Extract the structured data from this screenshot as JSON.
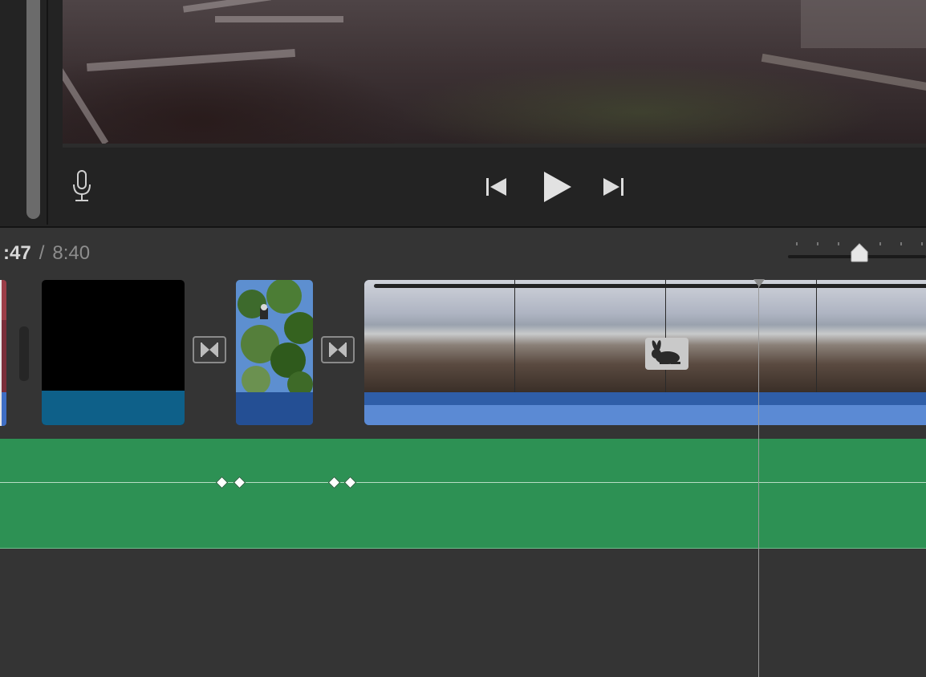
{
  "viewer": {
    "controls": {
      "mic_icon": "microphone-icon",
      "previous_icon": "skip-back-icon",
      "play_icon": "play-icon",
      "next_icon": "skip-forward-icon"
    }
  },
  "timeline": {
    "current_time": ":47",
    "separator": "/",
    "total_time": "8:40",
    "zoom_label_icon": "zoom-slider",
    "clips": [
      {
        "name": "black-clip",
        "type": "video"
      },
      {
        "name": "tree-clip",
        "type": "photo"
      },
      {
        "name": "beach-clip",
        "type": "video",
        "speed_icon": "rabbit-icon"
      }
    ],
    "transitions": [
      {
        "icon": "bowtie-transition-icon"
      },
      {
        "icon": "bowtie-transition-icon"
      }
    ]
  },
  "colors": {
    "music_track": "#2d9154",
    "clip_audio_blue": "#2f5ea8",
    "background": "#343434"
  }
}
